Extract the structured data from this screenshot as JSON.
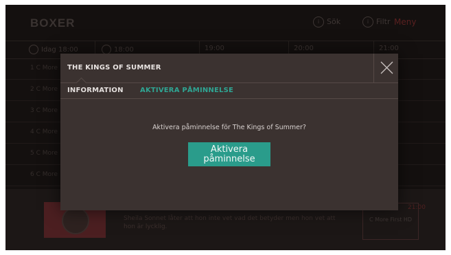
{
  "background": {
    "logo": "BOXER",
    "top_buttons": [
      {
        "icon": "info-icon",
        "label": "Sök"
      },
      {
        "icon": "filter-icon",
        "label": "Filtr"
      }
    ],
    "menu_label": "Meny",
    "timeline": [
      {
        "icon": "clock-icon",
        "label": "Idag 18:00"
      },
      {
        "icon": "clock-icon",
        "label": "18:00"
      },
      {
        "label": "19:00"
      },
      {
        "label": "20:00"
      },
      {
        "label": "21:00"
      }
    ],
    "channel_rows": [
      "1 C More",
      "2 C More",
      "3 C More",
      "4 C More",
      "5 C More",
      "6 C More"
    ],
    "bottom": {
      "description": "Sheila Sonnet låter att hon inte vet vad det betyder men hon vet att hon är lycklig.",
      "side_label_1": "21:00",
      "side_label_2": "C More First HD"
    },
    "colors": {
      "screen_bg": "#14100f",
      "menu_red": "#5a2020"
    }
  },
  "dialog": {
    "title": "THE KINGS OF SUMMER",
    "tabs": [
      {
        "id": "information",
        "label": "INFORMATION",
        "active": false
      },
      {
        "id": "aktivera",
        "label": "AKTIVERA PÅMINNELSE",
        "active": true
      }
    ],
    "prompt": "Aktivera påminnelse för The Kings of Summer?",
    "button_label": "Aktivera påminnelse",
    "colors": {
      "bg": "#3b3230",
      "accent": "#2fa593",
      "button": "#2a9c8b"
    }
  }
}
